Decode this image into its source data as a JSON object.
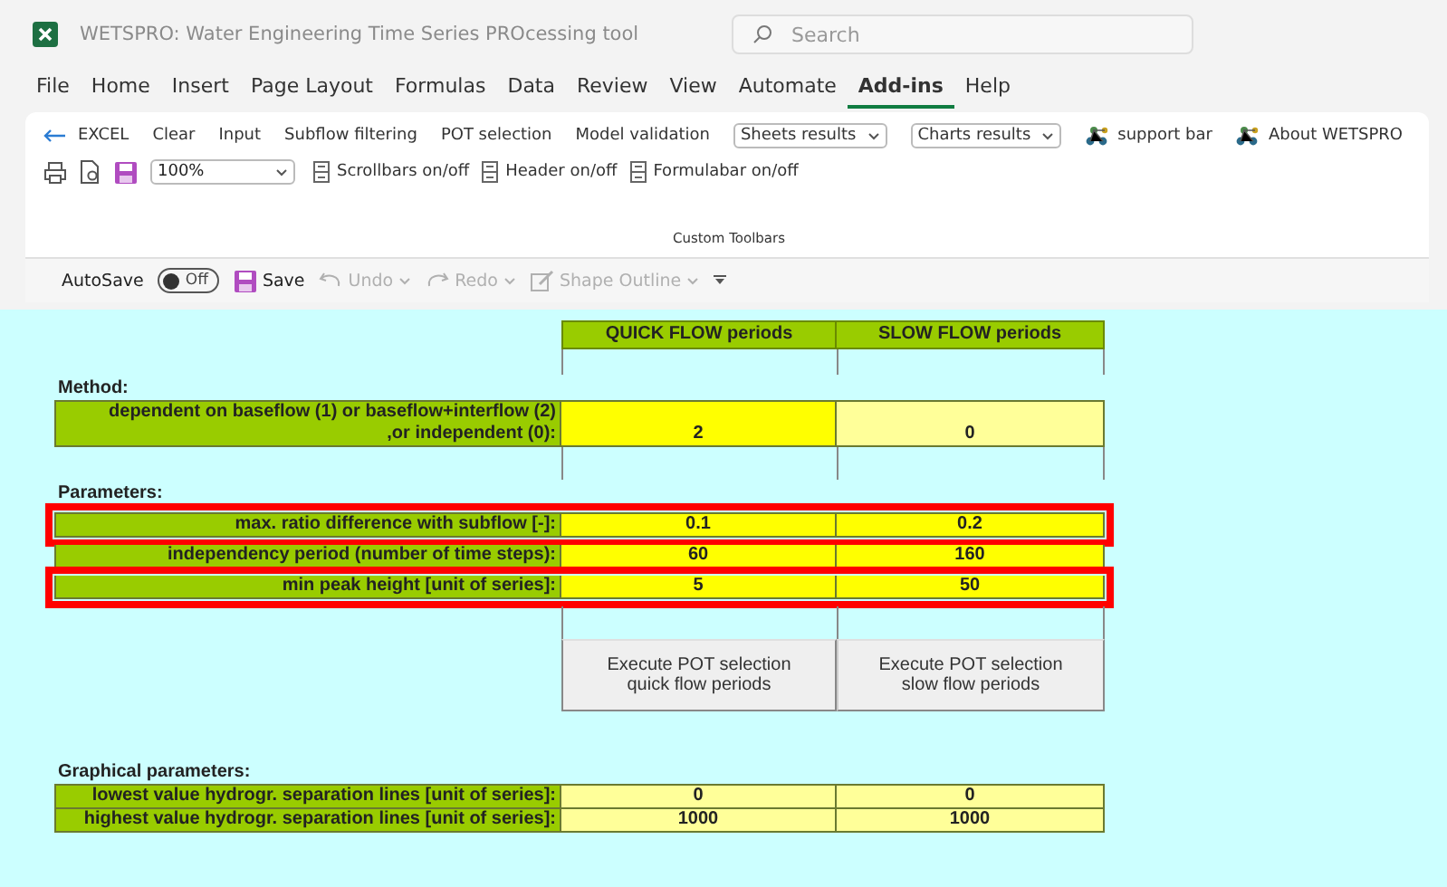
{
  "window": {
    "title": "WETSPRO: Water Engineering Time Series PROcessing tool"
  },
  "search": {
    "placeholder": "Search"
  },
  "menu_tabs": [
    {
      "label": "File",
      "selected": false
    },
    {
      "label": "Home",
      "selected": false
    },
    {
      "label": "Insert",
      "selected": false
    },
    {
      "label": "Page Layout",
      "selected": false
    },
    {
      "label": "Formulas",
      "selected": false
    },
    {
      "label": "Data",
      "selected": false
    },
    {
      "label": "Review",
      "selected": false
    },
    {
      "label": "View",
      "selected": false
    },
    {
      "label": "Automate",
      "selected": false
    },
    {
      "label": "Add-ins",
      "selected": true
    },
    {
      "label": "Help",
      "selected": false
    }
  ],
  "ribbon": {
    "row1": [
      {
        "kind": "back",
        "label": "EXCEL"
      },
      {
        "kind": "button",
        "label": "Clear"
      },
      {
        "kind": "button",
        "label": "Input"
      },
      {
        "kind": "button",
        "label": "Subflow filtering"
      },
      {
        "kind": "button",
        "label": "POT selection"
      },
      {
        "kind": "button",
        "label": "Model validation"
      },
      {
        "kind": "dropdown",
        "label": "Sheets results"
      },
      {
        "kind": "dropdown",
        "label": "Charts results"
      },
      {
        "kind": "addin",
        "label": "support bar"
      },
      {
        "kind": "addin",
        "label": "About WETSPRO"
      }
    ],
    "row2": [
      {
        "kind": "print"
      },
      {
        "kind": "preview"
      },
      {
        "kind": "save"
      },
      {
        "kind": "zoom",
        "label": "100%"
      },
      {
        "kind": "toggle",
        "label": "Scrollbars on/off"
      },
      {
        "kind": "toggle",
        "label": "Header on/off"
      },
      {
        "kind": "toggle",
        "label": "Formulabar on/off"
      }
    ],
    "group_label": "Custom Toolbars"
  },
  "quick_access": {
    "autosave_label": "AutoSave",
    "autosave": {
      "on": false,
      "label": "Off"
    },
    "items": [
      {
        "kind": "save",
        "label": "Save",
        "disabled": false
      },
      {
        "kind": "undo",
        "label": "Undo",
        "disabled": true
      },
      {
        "kind": "redo",
        "label": "Redo",
        "disabled": true
      },
      {
        "kind": "shape",
        "label": "Shape Outline",
        "disabled": true
      },
      {
        "kind": "more"
      }
    ]
  },
  "sheet": {
    "columns": [
      "QUICK FLOW periods",
      "SLOW FLOW periods"
    ],
    "upper_sections": [
      {
        "title": "Method:",
        "rows": [
          {
            "label": "dependent on baseflow (1) or baseflow+interflow (2)\n,or independent (0):",
            "highlighted": false,
            "values": [
              {
                "text": "2",
                "color": "#ffff00"
              },
              {
                "text": "0",
                "color": "#ffff99"
              }
            ]
          }
        ]
      },
      {
        "title": "Parameters:",
        "rows": [
          {
            "label": "max. ratio difference with subflow [-]:",
            "highlighted": true,
            "values": [
              {
                "text": "0.1",
                "color": "#ffff00"
              },
              {
                "text": "0.2",
                "color": "#ffff00"
              }
            ]
          },
          {
            "label": "independency period (number of time steps):",
            "highlighted": false,
            "values": [
              {
                "text": "60",
                "color": "#ffff00"
              },
              {
                "text": "160",
                "color": "#ffff00"
              }
            ]
          },
          {
            "label": "min peak height [unit of series]:",
            "highlighted": true,
            "values": [
              {
                "text": "5",
                "color": "#ffff00"
              },
              {
                "text": "50",
                "color": "#ffff00"
              }
            ]
          }
        ]
      }
    ],
    "buttons": [
      "Execute POT selection\nquick flow periods",
      "Execute POT selection\nslow flow periods"
    ],
    "lower_sections": [
      {
        "title": "Graphical parameters:",
        "rows": [
          {
            "label": "lowest value hydrogr. separation lines [unit of series]:",
            "highlighted": false,
            "values": [
              {
                "text": "0",
                "color": "#ffff99"
              },
              {
                "text": "0",
                "color": "#ffff99"
              }
            ]
          },
          {
            "label": "highest value hydrogr. separation lines [unit of series]:",
            "highlighted": false,
            "values": [
              {
                "text": "1000",
                "color": "#ffff99"
              },
              {
                "text": "1000",
                "color": "#ffff99"
              }
            ]
          }
        ]
      }
    ]
  }
}
